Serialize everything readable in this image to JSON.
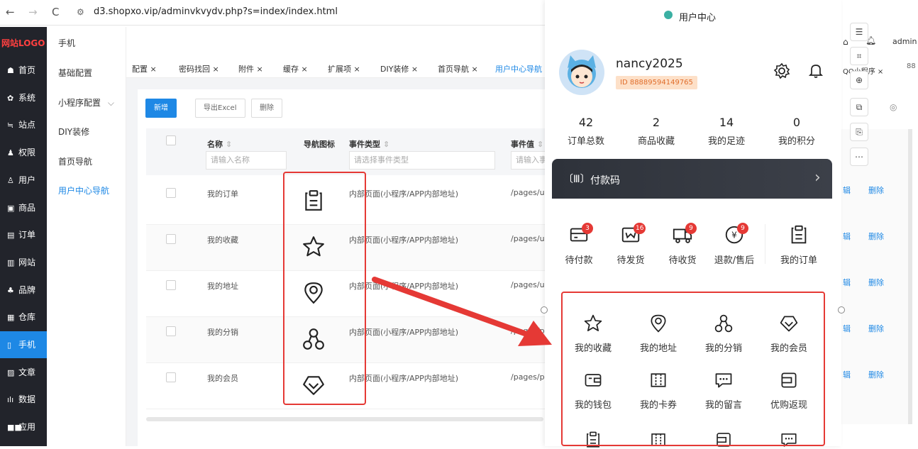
{
  "browser": {
    "url": "d3.shopxo.vip/adminvkvydv.php?s=index/index.html",
    "back": "←",
    "forward": "→",
    "reload": "C",
    "site": "⚙"
  },
  "sidebar": {
    "logo": "网站LOGO",
    "items": [
      {
        "icon": "☗",
        "label": "首页"
      },
      {
        "icon": "✿",
        "label": "系统"
      },
      {
        "icon": "≒",
        "label": "站点"
      },
      {
        "icon": "♟",
        "label": "权限"
      },
      {
        "icon": "♙",
        "label": "用户"
      },
      {
        "icon": "▣",
        "label": "商品"
      },
      {
        "icon": "▤",
        "label": "订单"
      },
      {
        "icon": "▥",
        "label": "网站"
      },
      {
        "icon": "♣",
        "label": "品牌"
      },
      {
        "icon": "▦",
        "label": "仓库"
      },
      {
        "icon": "▯",
        "label": "手机"
      },
      {
        "icon": "▨",
        "label": "文章"
      },
      {
        "icon": "ılı",
        "label": "数据"
      },
      {
        "icon": "■■",
        "label": "应用"
      }
    ]
  },
  "submenu": {
    "items": [
      "手机",
      "基础配置",
      "小程序配置",
      "DIY装修",
      "首页导航",
      "用户中心导航"
    ],
    "chevron": "⌵"
  },
  "tabs": [
    "配置 ×",
    "密码找回 ×",
    "附件 ×",
    "缓存 ×",
    "扩展项 ×",
    "DIY装修 ×",
    "首页导航 ×",
    "用户中心导航 ×"
  ],
  "toolbar": {
    "add": "新增",
    "export": "导出Excel",
    "delete": "删除"
  },
  "table": {
    "headers": {
      "name": "名称",
      "icon": "导航图标",
      "event_type": "事件类型",
      "event_value": "事件值"
    },
    "sort": "⇕",
    "filters": {
      "name": "请输入名称",
      "event_type": "请选择事件类型",
      "event_value": "请输入事"
    },
    "rows": [
      {
        "name": "我的订单",
        "event_type": "内部页面(小程序/APP内部地址)",
        "event_value": "/pages/user"
      },
      {
        "name": "我的收藏",
        "event_type": "内部页面(小程序/APP内部地址)",
        "event_value": "/pages/user"
      },
      {
        "name": "我的地址",
        "event_type": "内部页面(小程序/APP内部地址)",
        "event_value": "/pages/user"
      },
      {
        "name": "我的分销",
        "event_type": "内部页面(小程序/APP内部地址)",
        "event_value": "/pages/plug"
      },
      {
        "name": "我的会员",
        "event_type": "内部页面(小程序/APP内部地址)",
        "event_value": "/pages/plug"
      }
    ],
    "row_icons": [
      "clipboard-icon",
      "star-icon",
      "location-pin-icon",
      "distribution-icon",
      "diamond-icon"
    ]
  },
  "row_actions": {
    "edit": "辑",
    "delete": "删除"
  },
  "right_header": {
    "admin": "admin",
    "qq_tab": "QQ小程序 ×",
    "more": "88"
  },
  "phone": {
    "title": "用户中心",
    "username": "nancy2025",
    "user_id": "ID 88889594149765",
    "stats": [
      {
        "n": "42",
        "l": "订单总数"
      },
      {
        "n": "2",
        "l": "商品收藏"
      },
      {
        "n": "14",
        "l": "我的足迹"
      },
      {
        "n": "0",
        "l": "我的积分"
      }
    ],
    "pay": {
      "label": "付款码",
      "icon": "〔Ⅲ〕",
      "arrow": "›"
    },
    "orders": [
      {
        "label": "待付款",
        "badge": "3"
      },
      {
        "label": "待发货",
        "badge": "16"
      },
      {
        "label": "待收货",
        "badge": "9"
      },
      {
        "label": "退款/售后",
        "badge": "9"
      },
      {
        "label": "我的订单",
        "badge": ""
      }
    ],
    "grid": [
      {
        "label": "我的收藏",
        "icon": "star-icon"
      },
      {
        "label": "我的地址",
        "icon": "location-pin-icon"
      },
      {
        "label": "我的分销",
        "icon": "distribution-icon"
      },
      {
        "label": "我的会员",
        "icon": "diamond-icon"
      },
      {
        "label": "我的钱包",
        "icon": "wallet-icon"
      },
      {
        "label": "我的卡券",
        "icon": "coupon-icon"
      },
      {
        "label": "我的留言",
        "icon": "message-icon"
      },
      {
        "label": "优购返现",
        "icon": "cashback-icon"
      }
    ]
  },
  "colors": {
    "accent": "#1e88e5",
    "sidebar": "#22242b",
    "highlight": "#e53935"
  }
}
